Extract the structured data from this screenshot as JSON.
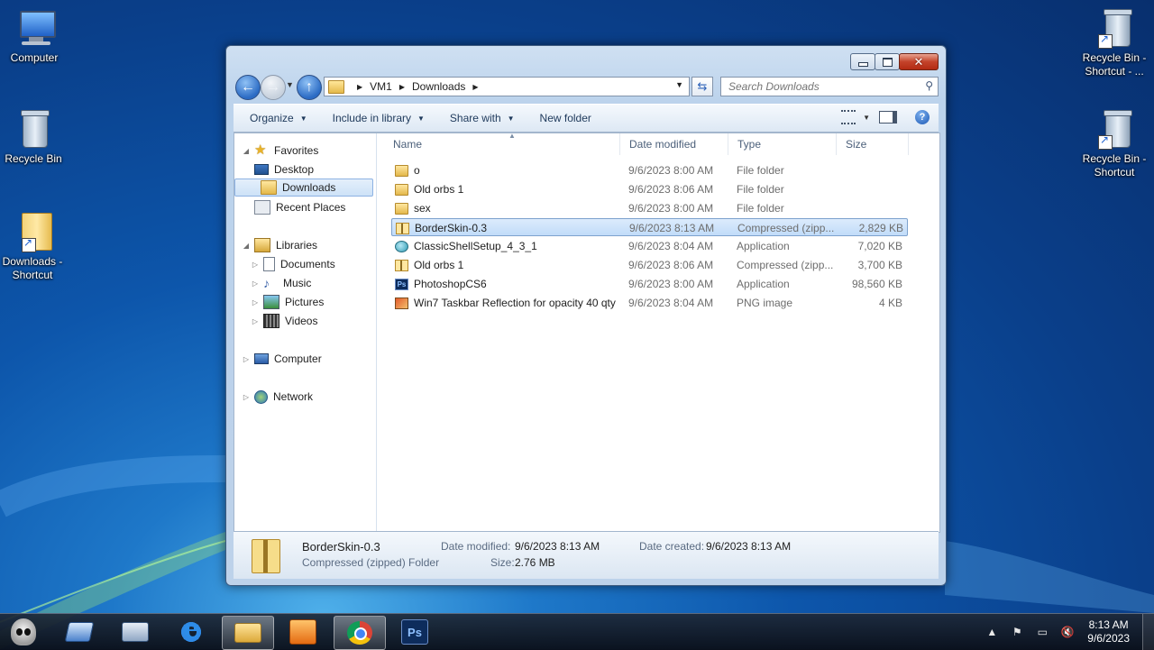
{
  "desktop": {
    "icons_left": [
      {
        "label": "Computer",
        "icon": "computer-icon"
      },
      {
        "label": "Recycle Bin",
        "icon": "recycle-bin-icon"
      },
      {
        "label": "Downloads - Shortcut",
        "icon": "folder-shortcut-icon"
      }
    ],
    "icons_right": [
      {
        "label": "Recycle Bin - Shortcut - ...",
        "icon": "recycle-bin-shortcut-icon"
      },
      {
        "label": "Recycle Bin - Shortcut",
        "icon": "recycle-bin-shortcut-icon"
      }
    ]
  },
  "window": {
    "breadcrumb": [
      "VM1",
      "Downloads"
    ],
    "search_placeholder": "Search Downloads",
    "toolbar": {
      "organize": "Organize",
      "include_in_library": "Include in library",
      "share_with": "Share with",
      "new_folder": "New folder"
    },
    "nav": {
      "favorites": "Favorites",
      "desktop": "Desktop",
      "downloads": "Downloads",
      "recent_places": "Recent Places",
      "libraries": "Libraries",
      "documents": "Documents",
      "music": "Music",
      "pictures": "Pictures",
      "videos": "Videos",
      "computer": "Computer",
      "network": "Network"
    },
    "columns": {
      "name": "Name",
      "date": "Date modified",
      "type": "Type",
      "size": "Size"
    },
    "files": [
      {
        "name": "o",
        "date": "9/6/2023 8:00 AM",
        "type": "File folder",
        "size": "",
        "icon": "folder"
      },
      {
        "name": "Old orbs 1",
        "date": "9/6/2023 8:06 AM",
        "type": "File folder",
        "size": "",
        "icon": "folder"
      },
      {
        "name": "sex",
        "date": "9/6/2023 8:00 AM",
        "type": "File folder",
        "size": "",
        "icon": "folder"
      },
      {
        "name": "BorderSkin-0.3",
        "date": "9/6/2023 8:13 AM",
        "type": "Compressed (zipp...",
        "size": "2,829 KB",
        "icon": "zip",
        "selected": true
      },
      {
        "name": "ClassicShellSetup_4_3_1",
        "date": "9/6/2023 8:04 AM",
        "type": "Application",
        "size": "7,020 KB",
        "icon": "app"
      },
      {
        "name": "Old orbs 1",
        "date": "9/6/2023 8:06 AM",
        "type": "Compressed (zipp...",
        "size": "3,700 KB",
        "icon": "zip"
      },
      {
        "name": "PhotoshopCS6",
        "date": "9/6/2023 8:00 AM",
        "type": "Application",
        "size": "98,560 KB",
        "icon": "ps"
      },
      {
        "name": "Win7 Taskbar Reflection for opacity 40 qty",
        "date": "9/6/2023 8:04 AM",
        "type": "PNG image",
        "size": "4 KB",
        "icon": "png"
      }
    ],
    "details": {
      "name": "BorderSkin-0.3",
      "type": "Compressed (zipped) Folder",
      "date_modified_label": "Date modified:",
      "date_modified": "9/6/2023 8:13 AM",
      "date_created_label": "Date created:",
      "date_created": "9/6/2023 8:13 AM",
      "size_label": "Size:",
      "size": "2.76 MB"
    }
  },
  "taskbar": {
    "apps": [
      "start-orb",
      "remote-desktop",
      "on-screen-keyboard",
      "internet-explorer",
      "windows-explorer",
      "media-player",
      "google-chrome",
      "photoshop"
    ],
    "clock_time": "8:13 AM",
    "clock_date": "9/6/2023"
  }
}
